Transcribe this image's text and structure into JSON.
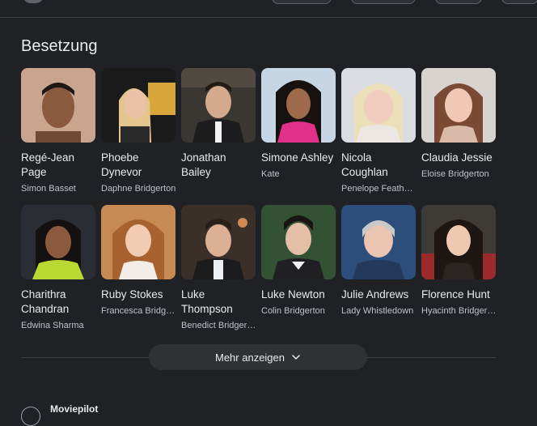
{
  "section_title": "Besetzung",
  "cast": [
    {
      "name": "Regé-Jean Page",
      "role": "Simon Basset"
    },
    {
      "name": "Phoebe Dynevor",
      "role": "Daphne Bridgerton"
    },
    {
      "name": "Jonathan Bailey",
      "role": ""
    },
    {
      "name": "Simone Ashley",
      "role": "Kate"
    },
    {
      "name": "Nicola Coughlan",
      "role": "Penelope Feath…"
    },
    {
      "name": "Claudia Jessie",
      "role": "Eloise Bridgerton"
    },
    {
      "name": "Charithra Chandran",
      "role": "Edwina Sharma"
    },
    {
      "name": "Ruby Stokes",
      "role": "Francesca Bridg…"
    },
    {
      "name": "Luke Thompson",
      "role": "Benedict Bridger…"
    },
    {
      "name": "Luke Newton",
      "role": "Colin Bridgerton"
    },
    {
      "name": "Julie Andrews",
      "role": "Lady Whistledown"
    },
    {
      "name": "Florence Hunt",
      "role": "Hyacinth Bridger…"
    }
  ],
  "more_button": {
    "label": "Mehr anzeigen"
  },
  "source": {
    "label": "Moviepilot"
  },
  "colors": {
    "background": "#202124",
    "card_text": "#e8eaed",
    "secondary_text": "#bdc1c6",
    "button_bg": "#303134"
  }
}
